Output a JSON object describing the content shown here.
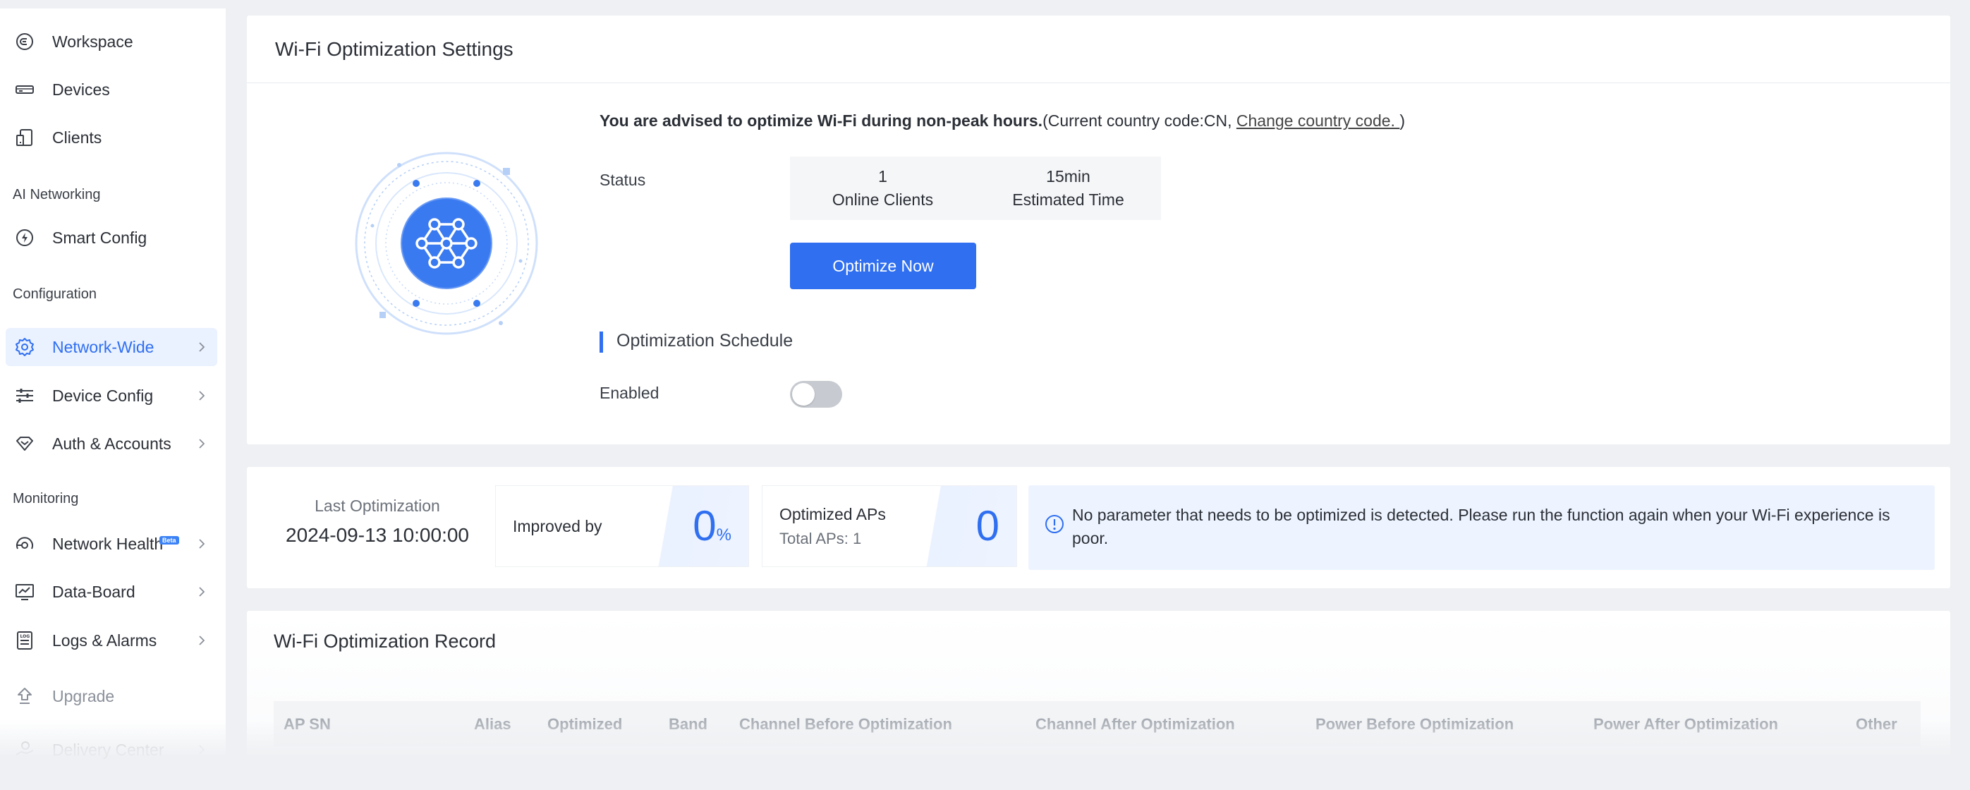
{
  "sidebar": {
    "items": [
      {
        "label": "Workspace",
        "icon": "workspace-icon"
      },
      {
        "label": "Devices",
        "icon": "devices-icon"
      },
      {
        "label": "Clients",
        "icon": "clients-icon"
      },
      {
        "label": "Smart Config",
        "icon": "smart-config-icon"
      },
      {
        "label": "Network-Wide",
        "icon": "gear-icon"
      },
      {
        "label": "Device Config",
        "icon": "sliders-icon"
      },
      {
        "label": "Auth & Accounts",
        "icon": "auth-icon"
      },
      {
        "label": "Network Health",
        "icon": "network-health-icon",
        "badge": "Beta"
      },
      {
        "label": "Data-Board",
        "icon": "data-board-icon"
      },
      {
        "label": "Logs & Alarms",
        "icon": "logs-icon"
      },
      {
        "label": "Upgrade",
        "icon": "upgrade-icon"
      },
      {
        "label": "Delivery Center",
        "icon": "delivery-icon"
      }
    ],
    "sections": {
      "ai_networking": "AI Networking",
      "configuration": "Configuration",
      "monitoring": "Monitoring"
    }
  },
  "settings": {
    "title": "Wi-Fi Optimization Settings",
    "advice_bold": "You are advised to optimize Wi-Fi during non-peak hours.",
    "advice_country": "(Current country code:CN, ",
    "advice_link": "Change country code. ",
    "advice_end": ")",
    "status_label": "Status",
    "online_clients_value": "1",
    "online_clients_label": "Online Clients",
    "estimated_time_value": "15min",
    "estimated_time_label": "Estimated Time",
    "optimize_button": "Optimize Now",
    "schedule_title": "Optimization Schedule",
    "enabled_label": "Enabled",
    "schedule_enabled": false
  },
  "summary": {
    "last_optimization_label": "Last Optimization",
    "last_optimization_date": "2024-09-13 10:00:00",
    "improved_by_label": "Improved by",
    "improved_by_value": "0",
    "improved_by_unit": "%",
    "optimized_aps_label": "Optimized APs",
    "total_aps_label": "Total APs: 1",
    "optimized_aps_value": "0",
    "info_message": "No parameter that needs to be optimized is detected. Please run the function again when your Wi-Fi experience is poor."
  },
  "record": {
    "title": "Wi-Fi Optimization Record",
    "columns": [
      "AP SN",
      "Alias",
      "Optimized",
      "Band",
      "Channel Before Optimization",
      "Channel After Optimization",
      "Power Before Optimization",
      "Power After Optimization",
      "Other"
    ]
  },
  "colors": {
    "accent": "#2f6ff0",
    "active_bg": "#eaf1ff",
    "page_bg": "#eef0f3"
  }
}
